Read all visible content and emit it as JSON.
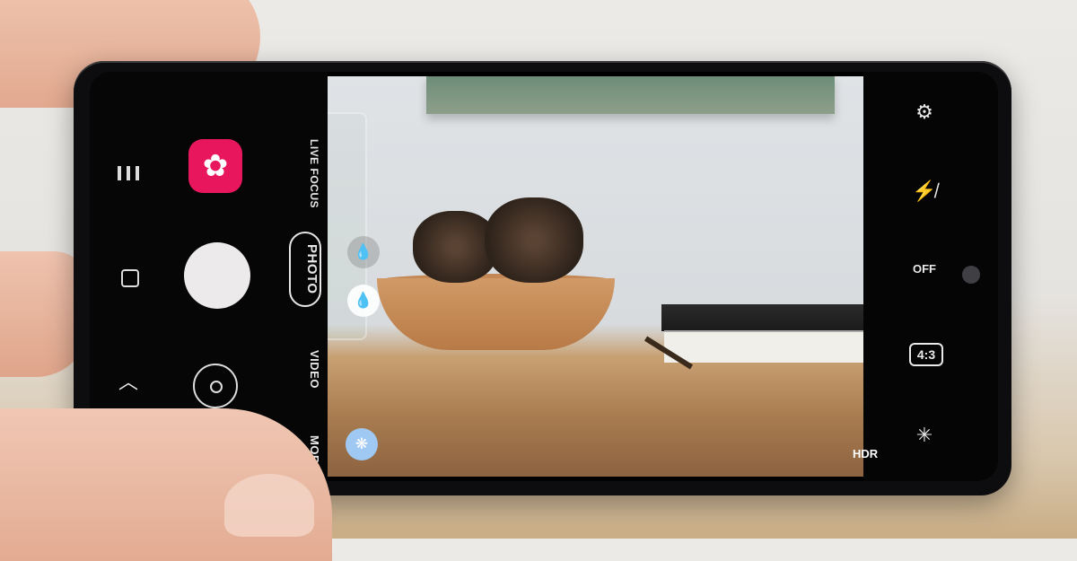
{
  "camera": {
    "left_bar": {
      "menu_icon": "menu-icon",
      "home_icon": "home-icon",
      "back_icon": "chevron-up-icon",
      "bixby_vision_icon": "flower-icon",
      "shutter_icon": "shutter-button",
      "flip_icon": "camera-flip-icon"
    },
    "modes": [
      "LIVE FOCUS",
      "PHOTO",
      "VIDEO",
      "MORE"
    ],
    "viewfinder": {
      "icons": [
        "water-drop-outline-icon",
        "water-drop-icon",
        "scene-optimizer-icon"
      ]
    },
    "right_bar": {
      "settings_icon": "gear-icon",
      "flash_icon": "flash-off-icon",
      "timer_label": "OFF",
      "ratio_label": "4:3",
      "effect_icon": "sparkle-icon",
      "hdr_label": "HDR"
    }
  }
}
